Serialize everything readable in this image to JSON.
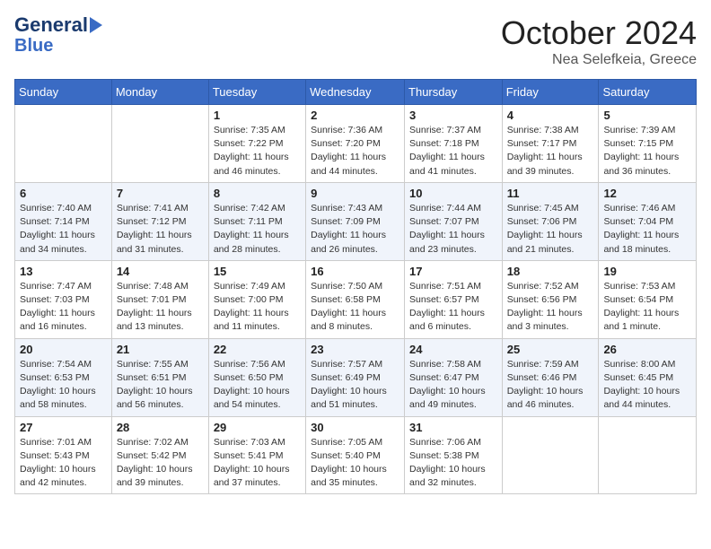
{
  "logo": {
    "line1": "General",
    "line2": "Blue"
  },
  "title": "October 2024",
  "subtitle": "Nea Selefkeia, Greece",
  "days_of_week": [
    "Sunday",
    "Monday",
    "Tuesday",
    "Wednesday",
    "Thursday",
    "Friday",
    "Saturday"
  ],
  "weeks": [
    [
      {
        "day": "",
        "info": ""
      },
      {
        "day": "",
        "info": ""
      },
      {
        "day": "1",
        "info": "Sunrise: 7:35 AM\nSunset: 7:22 PM\nDaylight: 11 hours and 46 minutes."
      },
      {
        "day": "2",
        "info": "Sunrise: 7:36 AM\nSunset: 7:20 PM\nDaylight: 11 hours and 44 minutes."
      },
      {
        "day": "3",
        "info": "Sunrise: 7:37 AM\nSunset: 7:18 PM\nDaylight: 11 hours and 41 minutes."
      },
      {
        "day": "4",
        "info": "Sunrise: 7:38 AM\nSunset: 7:17 PM\nDaylight: 11 hours and 39 minutes."
      },
      {
        "day": "5",
        "info": "Sunrise: 7:39 AM\nSunset: 7:15 PM\nDaylight: 11 hours and 36 minutes."
      }
    ],
    [
      {
        "day": "6",
        "info": "Sunrise: 7:40 AM\nSunset: 7:14 PM\nDaylight: 11 hours and 34 minutes."
      },
      {
        "day": "7",
        "info": "Sunrise: 7:41 AM\nSunset: 7:12 PM\nDaylight: 11 hours and 31 minutes."
      },
      {
        "day": "8",
        "info": "Sunrise: 7:42 AM\nSunset: 7:11 PM\nDaylight: 11 hours and 28 minutes."
      },
      {
        "day": "9",
        "info": "Sunrise: 7:43 AM\nSunset: 7:09 PM\nDaylight: 11 hours and 26 minutes."
      },
      {
        "day": "10",
        "info": "Sunrise: 7:44 AM\nSunset: 7:07 PM\nDaylight: 11 hours and 23 minutes."
      },
      {
        "day": "11",
        "info": "Sunrise: 7:45 AM\nSunset: 7:06 PM\nDaylight: 11 hours and 21 minutes."
      },
      {
        "day": "12",
        "info": "Sunrise: 7:46 AM\nSunset: 7:04 PM\nDaylight: 11 hours and 18 minutes."
      }
    ],
    [
      {
        "day": "13",
        "info": "Sunrise: 7:47 AM\nSunset: 7:03 PM\nDaylight: 11 hours and 16 minutes."
      },
      {
        "day": "14",
        "info": "Sunrise: 7:48 AM\nSunset: 7:01 PM\nDaylight: 11 hours and 13 minutes."
      },
      {
        "day": "15",
        "info": "Sunrise: 7:49 AM\nSunset: 7:00 PM\nDaylight: 11 hours and 11 minutes."
      },
      {
        "day": "16",
        "info": "Sunrise: 7:50 AM\nSunset: 6:58 PM\nDaylight: 11 hours and 8 minutes."
      },
      {
        "day": "17",
        "info": "Sunrise: 7:51 AM\nSunset: 6:57 PM\nDaylight: 11 hours and 6 minutes."
      },
      {
        "day": "18",
        "info": "Sunrise: 7:52 AM\nSunset: 6:56 PM\nDaylight: 11 hours and 3 minutes."
      },
      {
        "day": "19",
        "info": "Sunrise: 7:53 AM\nSunset: 6:54 PM\nDaylight: 11 hours and 1 minute."
      }
    ],
    [
      {
        "day": "20",
        "info": "Sunrise: 7:54 AM\nSunset: 6:53 PM\nDaylight: 10 hours and 58 minutes."
      },
      {
        "day": "21",
        "info": "Sunrise: 7:55 AM\nSunset: 6:51 PM\nDaylight: 10 hours and 56 minutes."
      },
      {
        "day": "22",
        "info": "Sunrise: 7:56 AM\nSunset: 6:50 PM\nDaylight: 10 hours and 54 minutes."
      },
      {
        "day": "23",
        "info": "Sunrise: 7:57 AM\nSunset: 6:49 PM\nDaylight: 10 hours and 51 minutes."
      },
      {
        "day": "24",
        "info": "Sunrise: 7:58 AM\nSunset: 6:47 PM\nDaylight: 10 hours and 49 minutes."
      },
      {
        "day": "25",
        "info": "Sunrise: 7:59 AM\nSunset: 6:46 PM\nDaylight: 10 hours and 46 minutes."
      },
      {
        "day": "26",
        "info": "Sunrise: 8:00 AM\nSunset: 6:45 PM\nDaylight: 10 hours and 44 minutes."
      }
    ],
    [
      {
        "day": "27",
        "info": "Sunrise: 7:01 AM\nSunset: 5:43 PM\nDaylight: 10 hours and 42 minutes."
      },
      {
        "day": "28",
        "info": "Sunrise: 7:02 AM\nSunset: 5:42 PM\nDaylight: 10 hours and 39 minutes."
      },
      {
        "day": "29",
        "info": "Sunrise: 7:03 AM\nSunset: 5:41 PM\nDaylight: 10 hours and 37 minutes."
      },
      {
        "day": "30",
        "info": "Sunrise: 7:05 AM\nSunset: 5:40 PM\nDaylight: 10 hours and 35 minutes."
      },
      {
        "day": "31",
        "info": "Sunrise: 7:06 AM\nSunset: 5:38 PM\nDaylight: 10 hours and 32 minutes."
      },
      {
        "day": "",
        "info": ""
      },
      {
        "day": "",
        "info": ""
      }
    ]
  ]
}
